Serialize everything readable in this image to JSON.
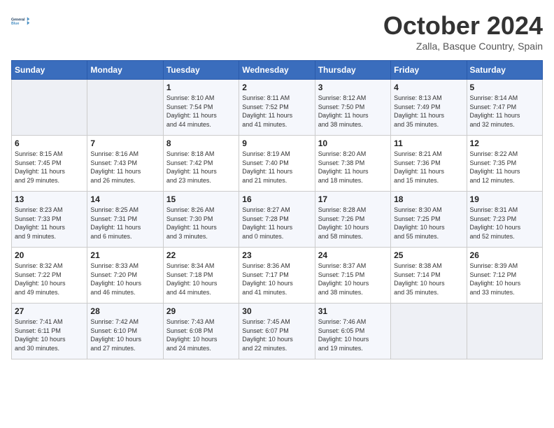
{
  "header": {
    "logo_line1": "General",
    "logo_line2": "Blue",
    "month": "October 2024",
    "location": "Zalla, Basque Country, Spain"
  },
  "weekdays": [
    "Sunday",
    "Monday",
    "Tuesday",
    "Wednesday",
    "Thursday",
    "Friday",
    "Saturday"
  ],
  "weeks": [
    [
      {
        "day": "",
        "detail": ""
      },
      {
        "day": "",
        "detail": ""
      },
      {
        "day": "1",
        "detail": "Sunrise: 8:10 AM\nSunset: 7:54 PM\nDaylight: 11 hours\nand 44 minutes."
      },
      {
        "day": "2",
        "detail": "Sunrise: 8:11 AM\nSunset: 7:52 PM\nDaylight: 11 hours\nand 41 minutes."
      },
      {
        "day": "3",
        "detail": "Sunrise: 8:12 AM\nSunset: 7:50 PM\nDaylight: 11 hours\nand 38 minutes."
      },
      {
        "day": "4",
        "detail": "Sunrise: 8:13 AM\nSunset: 7:49 PM\nDaylight: 11 hours\nand 35 minutes."
      },
      {
        "day": "5",
        "detail": "Sunrise: 8:14 AM\nSunset: 7:47 PM\nDaylight: 11 hours\nand 32 minutes."
      }
    ],
    [
      {
        "day": "6",
        "detail": "Sunrise: 8:15 AM\nSunset: 7:45 PM\nDaylight: 11 hours\nand 29 minutes."
      },
      {
        "day": "7",
        "detail": "Sunrise: 8:16 AM\nSunset: 7:43 PM\nDaylight: 11 hours\nand 26 minutes."
      },
      {
        "day": "8",
        "detail": "Sunrise: 8:18 AM\nSunset: 7:42 PM\nDaylight: 11 hours\nand 23 minutes."
      },
      {
        "day": "9",
        "detail": "Sunrise: 8:19 AM\nSunset: 7:40 PM\nDaylight: 11 hours\nand 21 minutes."
      },
      {
        "day": "10",
        "detail": "Sunrise: 8:20 AM\nSunset: 7:38 PM\nDaylight: 11 hours\nand 18 minutes."
      },
      {
        "day": "11",
        "detail": "Sunrise: 8:21 AM\nSunset: 7:36 PM\nDaylight: 11 hours\nand 15 minutes."
      },
      {
        "day": "12",
        "detail": "Sunrise: 8:22 AM\nSunset: 7:35 PM\nDaylight: 11 hours\nand 12 minutes."
      }
    ],
    [
      {
        "day": "13",
        "detail": "Sunrise: 8:23 AM\nSunset: 7:33 PM\nDaylight: 11 hours\nand 9 minutes."
      },
      {
        "day": "14",
        "detail": "Sunrise: 8:25 AM\nSunset: 7:31 PM\nDaylight: 11 hours\nand 6 minutes."
      },
      {
        "day": "15",
        "detail": "Sunrise: 8:26 AM\nSunset: 7:30 PM\nDaylight: 11 hours\nand 3 minutes."
      },
      {
        "day": "16",
        "detail": "Sunrise: 8:27 AM\nSunset: 7:28 PM\nDaylight: 11 hours\nand 0 minutes."
      },
      {
        "day": "17",
        "detail": "Sunrise: 8:28 AM\nSunset: 7:26 PM\nDaylight: 10 hours\nand 58 minutes."
      },
      {
        "day": "18",
        "detail": "Sunrise: 8:30 AM\nSunset: 7:25 PM\nDaylight: 10 hours\nand 55 minutes."
      },
      {
        "day": "19",
        "detail": "Sunrise: 8:31 AM\nSunset: 7:23 PM\nDaylight: 10 hours\nand 52 minutes."
      }
    ],
    [
      {
        "day": "20",
        "detail": "Sunrise: 8:32 AM\nSunset: 7:22 PM\nDaylight: 10 hours\nand 49 minutes."
      },
      {
        "day": "21",
        "detail": "Sunrise: 8:33 AM\nSunset: 7:20 PM\nDaylight: 10 hours\nand 46 minutes."
      },
      {
        "day": "22",
        "detail": "Sunrise: 8:34 AM\nSunset: 7:18 PM\nDaylight: 10 hours\nand 44 minutes."
      },
      {
        "day": "23",
        "detail": "Sunrise: 8:36 AM\nSunset: 7:17 PM\nDaylight: 10 hours\nand 41 minutes."
      },
      {
        "day": "24",
        "detail": "Sunrise: 8:37 AM\nSunset: 7:15 PM\nDaylight: 10 hours\nand 38 minutes."
      },
      {
        "day": "25",
        "detail": "Sunrise: 8:38 AM\nSunset: 7:14 PM\nDaylight: 10 hours\nand 35 minutes."
      },
      {
        "day": "26",
        "detail": "Sunrise: 8:39 AM\nSunset: 7:12 PM\nDaylight: 10 hours\nand 33 minutes."
      }
    ],
    [
      {
        "day": "27",
        "detail": "Sunrise: 7:41 AM\nSunset: 6:11 PM\nDaylight: 10 hours\nand 30 minutes."
      },
      {
        "day": "28",
        "detail": "Sunrise: 7:42 AM\nSunset: 6:10 PM\nDaylight: 10 hours\nand 27 minutes."
      },
      {
        "day": "29",
        "detail": "Sunrise: 7:43 AM\nSunset: 6:08 PM\nDaylight: 10 hours\nand 24 minutes."
      },
      {
        "day": "30",
        "detail": "Sunrise: 7:45 AM\nSunset: 6:07 PM\nDaylight: 10 hours\nand 22 minutes."
      },
      {
        "day": "31",
        "detail": "Sunrise: 7:46 AM\nSunset: 6:05 PM\nDaylight: 10 hours\nand 19 minutes."
      },
      {
        "day": "",
        "detail": ""
      },
      {
        "day": "",
        "detail": ""
      }
    ]
  ]
}
